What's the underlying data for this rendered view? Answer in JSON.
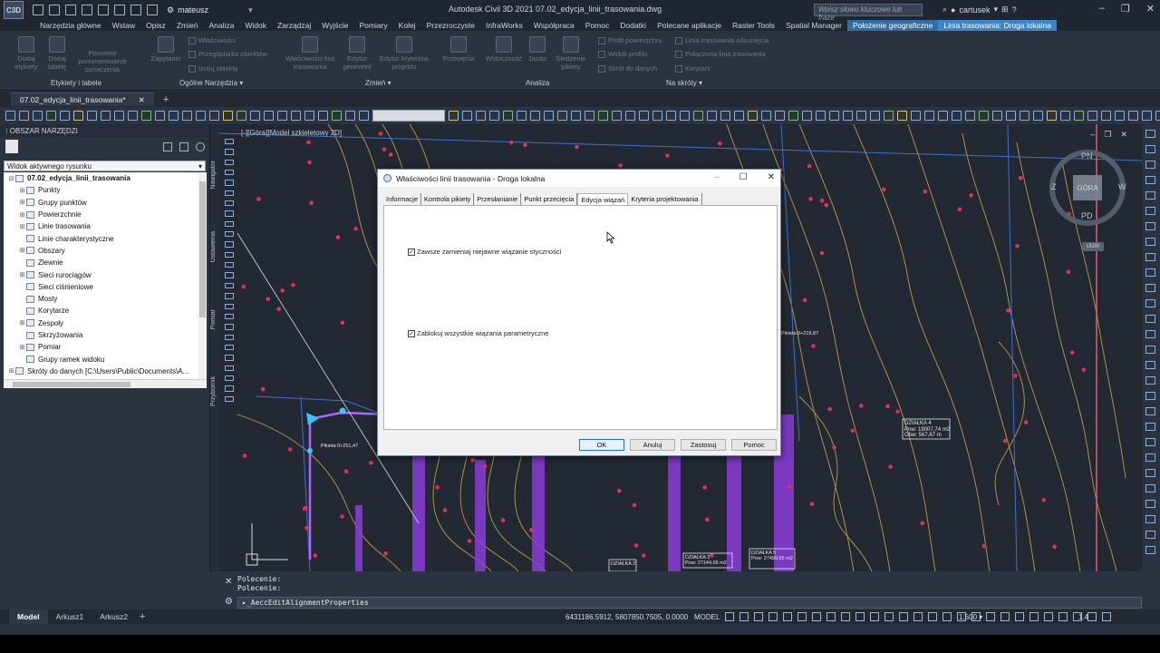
{
  "app": {
    "title": "Autodesk Civil 3D 2021   07.02_edycja_linii_trasowania.dwg",
    "workspace": "mateusz",
    "search_placeholder": "Wpisz słowo kluczowe lub frazę",
    "user": "cartusek",
    "logo_text": "C3D"
  },
  "ribbon": {
    "tabs": [
      {
        "label": "Narzędzia główne"
      },
      {
        "label": "Wstaw"
      },
      {
        "label": "Opisz"
      },
      {
        "label": "Zmień"
      },
      {
        "label": "Analiza"
      },
      {
        "label": "Widok"
      },
      {
        "label": "Zarządzaj"
      },
      {
        "label": "Wyjście"
      },
      {
        "label": "Pomiary"
      },
      {
        "label": "Kolej"
      },
      {
        "label": "Przezroczyste"
      },
      {
        "label": "InfraWorks"
      },
      {
        "label": "Współpraca"
      },
      {
        "label": "Pomoc"
      },
      {
        "label": "Dodatki"
      },
      {
        "label": "Polecane aplikacje"
      },
      {
        "label": "Raster Tools"
      },
      {
        "label": "Spatial Manager"
      },
      {
        "label": "Położenie geograficzne"
      },
      {
        "label": "Linia trasowania: Droga lokalna"
      }
    ],
    "buttons": {
      "dodaj_etykiety": "Dodaj etykiety",
      "dodaj_tabele": "Dodaj tabelę",
      "ponowne": "Ponowne ponumerowanie oznaczenia",
      "zapytanie": "Zapytanie",
      "wlasciwosci": "Właściwości",
      "przegladarka": "Przeglądarka obiektów",
      "izoluj": "Izoluj obiekty",
      "wl_linii": "Właściwości linii trasowania",
      "edytor_geom": "Edytor geometrii",
      "edytor_kryt": "Edytor kryteriów projektu",
      "przeciecia": "Przecięcia",
      "widocznosc": "Widoczność",
      "jazda": "Jazda",
      "sledzenie": "Śledzenie pikiety",
      "profil": "Profil powierzchni",
      "widok_profilu": "Widok profilu",
      "skrot": "Skrót do danych",
      "linia_odsun": "Linia trasowania odsunięcia",
      "polaczona": "Połączona linia trasowania",
      "korytarz": "Korytarz"
    },
    "panels": {
      "etykiety": "Etykiety i tabele",
      "ogolne": "Ogólne Narzędzia",
      "zmien": "Zmień",
      "analiza": "Analiza",
      "skroty": "Na skróty"
    }
  },
  "doc_tab": "07.02_edycja_linii_trasowania*",
  "toolspace": {
    "title": "OBSZAR NARZĘDZI",
    "view_select": "Widok aktywnego rysunku",
    "tree": [
      {
        "label": "07.02_edycja_linii_trasowania",
        "bold": true,
        "exp": "⊟",
        "indent": 0
      },
      {
        "label": "Punkty",
        "exp": "⊞",
        "indent": 1
      },
      {
        "label": "Grupy punktów",
        "exp": "⊞",
        "indent": 1
      },
      {
        "label": "Powierzchnie",
        "exp": "⊞",
        "indent": 1
      },
      {
        "label": "Linie trasowania",
        "exp": "⊞",
        "indent": 1
      },
      {
        "label": "Linie charakterystyczne",
        "exp": "",
        "indent": 1
      },
      {
        "label": "Obszary",
        "exp": "⊞",
        "indent": 1
      },
      {
        "label": "Zlewnie",
        "exp": "",
        "indent": 1
      },
      {
        "label": "Sieci rurociągów",
        "exp": "⊞",
        "indent": 1
      },
      {
        "label": "Sieci ciśnieniowe",
        "exp": "",
        "indent": 1
      },
      {
        "label": "Mosty",
        "exp": "",
        "indent": 1
      },
      {
        "label": "Korytarze",
        "exp": "",
        "indent": 1
      },
      {
        "label": "Zespoły",
        "exp": "⊞",
        "indent": 1
      },
      {
        "label": "Skrzyżowania",
        "exp": "",
        "indent": 1
      },
      {
        "label": "Pomiar",
        "exp": "⊞",
        "indent": 1
      },
      {
        "label": "Grupy ramek widoku",
        "exp": "",
        "indent": 1
      },
      {
        "label": "Skróty do danych [C:\\Users\\Public\\Documents\\A...",
        "exp": "⊞",
        "indent": 0
      }
    ],
    "side_tabs": [
      "Nawigator",
      "Ustawienia",
      "Pomiar",
      "Przybornik"
    ]
  },
  "viewport": {
    "label": "[-][Góra][Model szkieletowy 2D]",
    "compass": {
      "n": "PN",
      "s": "PD",
      "e": "W",
      "w": "Z",
      "top": "GÓRA",
      "ucs": "UUW"
    },
    "annotations": [
      {
        "id": "a1",
        "text": "DZIAŁKA 4"
      },
      {
        "id": "a2",
        "text": "Pow: 19007,74 m2"
      },
      {
        "id": "a3",
        "text": "Obw: 567,67 m"
      },
      {
        "id": "a4",
        "text": "DZIAŁKA 5"
      },
      {
        "id": "a5",
        "text": "Pow: 27499,65 m2"
      },
      {
        "id": "a6",
        "text": "DZIAŁKA 3"
      },
      {
        "id": "a7",
        "text": "Pow: 27144,66 m2"
      },
      {
        "id": "a8",
        "text": "DZIAŁKA 2"
      },
      {
        "id": "a9",
        "text": "Pikieta 0+251,47"
      },
      {
        "id": "a10",
        "text": "Pikieta 0+219,87"
      }
    ]
  },
  "dialog": {
    "title": "Właściwości linii trasowania - Droga lokalna",
    "tabs": [
      {
        "label": "Informacje",
        "selected": false
      },
      {
        "label": "Kontrola pikiety",
        "selected": false
      },
      {
        "label": "Przesłanianie",
        "selected": false
      },
      {
        "label": "Punkt przecięcia",
        "selected": false
      },
      {
        "label": "Edycja wiązań",
        "selected": true
      },
      {
        "label": "Kryteria projektowania",
        "selected": false
      }
    ],
    "check1": {
      "label": "Zawsze zamieniaj niejawne wiązanie styczności",
      "checked": true
    },
    "check2": {
      "label": "Zablokuj wszystkie wiązania parametryczne",
      "checked": true
    },
    "buttons": {
      "ok": "OK",
      "cancel": "Anuluj",
      "apply": "Zastosuj",
      "help": "Pomoc"
    }
  },
  "command": {
    "history": [
      "Polecenie:",
      "Polecenie:"
    ],
    "input": "▸_AeccEditAlignmentProperties"
  },
  "status": {
    "layouts": [
      {
        "label": "Model",
        "active": true
      },
      {
        "label": "Arkusz1",
        "active": false
      },
      {
        "label": "Arkusz2",
        "active": false
      }
    ],
    "coords": "6431186.5912, 5807850.7505, 0.0000",
    "model": "MODEL",
    "scale": "1:500",
    "zoom": "1.4"
  },
  "colors": {
    "contour": "#c9a94a",
    "accent": "#3a86c8",
    "alignment": "#8a3cd9",
    "points": "#e0305a"
  }
}
